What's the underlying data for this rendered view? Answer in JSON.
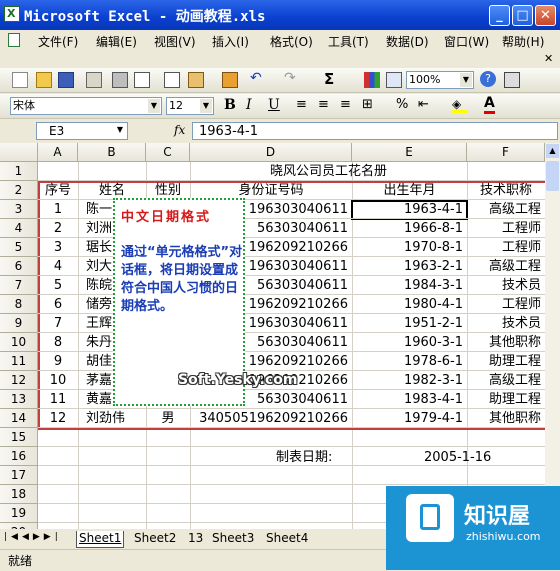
{
  "window": {
    "title": "Microsoft Excel - 动画教程.xls"
  },
  "menu": [
    "文件(F)",
    "编辑(E)",
    "视图(V)",
    "插入(I)",
    "格式(O)",
    "工具(T)",
    "数据(D)",
    "窗口(W)",
    "帮助(H)"
  ],
  "toolbar": {
    "zoom": "100%",
    "font": "宋体",
    "size": "12"
  },
  "formula_bar": {
    "cell_ref": "E3",
    "fx": "fx",
    "value": "1963-4-1"
  },
  "columns": [
    "A",
    "B",
    "C",
    "D",
    "E",
    "F"
  ],
  "rows": [
    "1",
    "2",
    "3",
    "4",
    "5",
    "6",
    "7",
    "8",
    "9",
    "10",
    "11",
    "12",
    "13",
    "14",
    "15",
    "16",
    "17",
    "18",
    "19",
    "20"
  ],
  "sheet": {
    "title": "晓风公司员工花名册",
    "headers": [
      "序号",
      "姓名",
      "性别",
      "身份证号码",
      "出生年月",
      "技术职称"
    ],
    "records": [
      {
        "no": "1",
        "name": "陈一",
        "sex": "",
        "id": "196303040611",
        "birth": "1963-4-1",
        "title": "高级工程"
      },
      {
        "no": "2",
        "name": "刘洲",
        "sex": "",
        "id": "56303040611",
        "birth": "1966-8-1",
        "title": "工程师"
      },
      {
        "no": "3",
        "name": "琚长",
        "sex": "",
        "id": "196209210266",
        "birth": "1970-8-1",
        "title": "工程师"
      },
      {
        "no": "4",
        "name": "刘大",
        "sex": "",
        "id": "196303040611",
        "birth": "1963-2-1",
        "title": "高级工程"
      },
      {
        "no": "5",
        "name": "陈皖",
        "sex": "",
        "id": "56303040611",
        "birth": "1984-3-1",
        "title": "技术员"
      },
      {
        "no": "6",
        "name": "储旁",
        "sex": "",
        "id": "196209210266",
        "birth": "1980-4-1",
        "title": "工程师"
      },
      {
        "no": "7",
        "name": "王辉",
        "sex": "",
        "id": "196303040611",
        "birth": "1951-2-1",
        "title": "技术员"
      },
      {
        "no": "8",
        "name": "朱丹",
        "sex": "",
        "id": "56303040611",
        "birth": "1960-3-1",
        "title": "其他职称"
      },
      {
        "no": "9",
        "name": "胡佳",
        "sex": "",
        "id": "196209210266",
        "birth": "1978-6-1",
        "title": "助理工程"
      },
      {
        "no": "10",
        "name": "茅嘉",
        "sex": "",
        "id": "196209210266",
        "birth": "1982-3-1",
        "title": "高级工程"
      },
      {
        "no": "11",
        "name": "黄嘉",
        "sex": "",
        "id": "56303040611",
        "birth": "1983-4-1",
        "title": "助理工程"
      },
      {
        "no": "12",
        "name": "刘劲伟",
        "sex": "男",
        "id": "340505196209210266",
        "birth": "1979-4-1",
        "title": "其他职称"
      }
    ],
    "footer_label": "制表日期:",
    "footer_date": "2005-1-16"
  },
  "callout": {
    "title": "中文日期格式",
    "body": "通过“单元格格式”对话框，将日期设置成符合中国人习惯的日期格式。"
  },
  "watermark": "Soft.Yesky.com",
  "tabs": [
    "Sheet1",
    "Sheet2",
    "13",
    "Sheet3",
    "Sheet4"
  ],
  "status": "就绪",
  "logo": {
    "title": "知识屋",
    "sub": "zhishiwu.com"
  }
}
